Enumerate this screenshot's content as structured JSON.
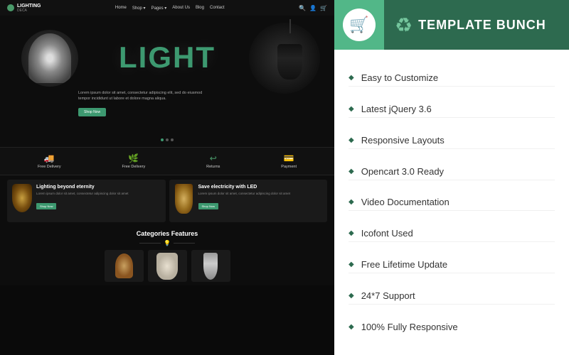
{
  "left": {
    "navbar": {
      "logo_text": "LIGHTING",
      "logo_sub": "DECA",
      "links": [
        "Home",
        "Shop ▾",
        "Pages ▾",
        "About Us",
        "Blog",
        "Contact"
      ]
    },
    "hero": {
      "title_part1": "LIGH",
      "title_part2": "T",
      "subtitle": "Lorem ipsum dolor sit amet, consectetur adipiscing elit, sed do eiusmod tempor incididunt ut labore et dolore magna aliqua.",
      "cta": "Shop Now",
      "dots": [
        true,
        false,
        false
      ]
    },
    "features": [
      {
        "icon": "🚚",
        "label": "Free Delivery"
      },
      {
        "icon": "🌿",
        "label": "Free Delivery"
      },
      {
        "icon": "↩",
        "label": "Returns"
      },
      {
        "icon": "💳",
        "label": "Payment"
      }
    ],
    "banners": [
      {
        "title": "Lighting beyond eternity",
        "desc": "Lorem ipsum dolor sit amet, consectetur adipiscing dolor sit amet",
        "cta": "Shop Now"
      },
      {
        "title": "Save electricity with LED",
        "desc": "Lorem ipsum dolor sit amet, consectetur adipiscing dolor sit amet",
        "cta": "Shop Now"
      }
    ],
    "categories": {
      "title": "Categories Features"
    }
  },
  "right": {
    "cart_icon": "🛒",
    "logo_icon": "♻",
    "brand_name": "TEMPLATE BUNCH",
    "features": [
      {
        "label": "Easy to Customize"
      },
      {
        "label": "Latest jQuery 3.6"
      },
      {
        "label": "Responsive Layouts"
      },
      {
        "label": "Opencart 3.0 Ready"
      },
      {
        "label": "Video Documentation"
      },
      {
        "label": "Icofont Used"
      },
      {
        "label": "Free Lifetime Update"
      },
      {
        "label": "24*7 Support"
      },
      {
        "label": "100% Fully Responsive"
      }
    ]
  }
}
